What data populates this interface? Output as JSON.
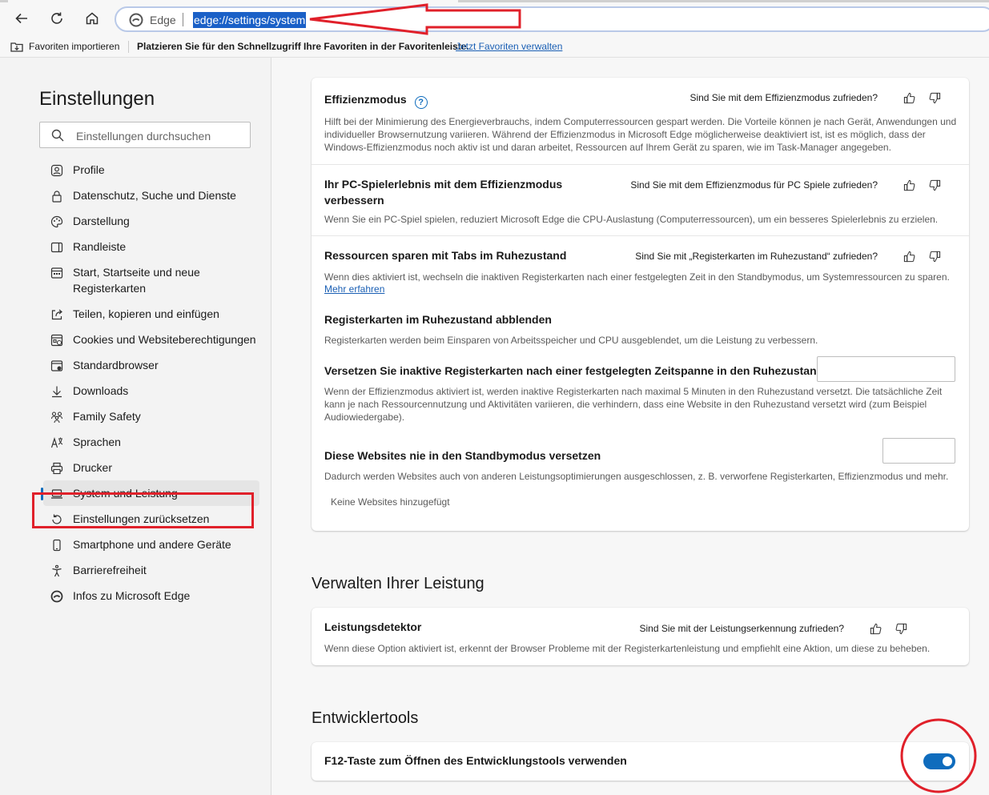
{
  "browser": {
    "address_prefix": "Edge",
    "url": "edge://settings/system"
  },
  "favorites_bar": {
    "import_label": "Favoriten importieren",
    "message": "Platzieren Sie für den Schnellzugriff Ihre Favoriten in der Favoritenleiste.",
    "manage_link": "Jetzt Favoriten verwalten"
  },
  "sidebar": {
    "title": "Einstellungen",
    "search_placeholder": "Einstellungen durchsuchen",
    "items": [
      {
        "label": "Profile",
        "icon": "profile-icon"
      },
      {
        "label": "Datenschutz, Suche und Dienste",
        "icon": "lock-icon"
      },
      {
        "label": "Darstellung",
        "icon": "palette-icon"
      },
      {
        "label": "Randleiste",
        "icon": "sidebar-panel-icon"
      },
      {
        "label": "Start, Startseite und neue Registerkarten",
        "icon": "home-grid-icon"
      },
      {
        "label": "Teilen, kopieren und einfügen",
        "icon": "share-icon"
      },
      {
        "label": "Cookies und Websiteberechtigungen",
        "icon": "cookie-permissions-icon"
      },
      {
        "label": "Standardbrowser",
        "icon": "browser-icon"
      },
      {
        "label": "Downloads",
        "icon": "download-icon"
      },
      {
        "label": "Family Safety",
        "icon": "family-icon"
      },
      {
        "label": "Sprachen",
        "icon": "language-icon"
      },
      {
        "label": "Drucker",
        "icon": "printer-icon"
      },
      {
        "label": "System und Leistung",
        "icon": "laptop-icon",
        "active": true
      },
      {
        "label": "Einstellungen zurücksetzen",
        "icon": "reset-icon"
      },
      {
        "label": "Smartphone und andere Geräte",
        "icon": "phone-icon"
      },
      {
        "label": "Barrierefreiheit",
        "icon": "accessibility-icon"
      },
      {
        "label": "Infos zu Microsoft Edge",
        "icon": "edge-logo-icon"
      }
    ]
  },
  "main": {
    "efficiency_card": {
      "efficiency_mode": {
        "title": "Effizienzmodus",
        "feedback": "Sind Sie mit dem Effizienzmodus zufrieden?",
        "desc": "Hilft bei der Minimierung des Energieverbrauchs, indem Computerressourcen gespart werden. Die Vorteile können je nach Gerät, Anwendungen und individueller Browsernutzung variieren. Während der Effizienzmodus in Microsoft Edge möglicherweise deaktiviert ist, ist es möglich, dass der Windows-Effizienzmodus noch aktiv ist und daran arbeitet, Ressourcen auf Ihrem Gerät zu sparen, wie im Task-Manager angegeben."
      },
      "gaming": {
        "title": "Ihr PC-Spielerlebnis mit dem Effizienzmodus verbessern",
        "feedback": "Sind Sie mit dem Effizienzmodus für PC Spiele zufrieden?",
        "desc": "Wenn Sie ein PC-Spiel spielen, reduziert Microsoft Edge die CPU-Auslastung (Computerressourcen), um ein besseres Spielerlebnis zu erzielen."
      },
      "sleeping_tabs": {
        "title": "Ressourcen sparen mit Tabs im Ruhezustand",
        "feedback": "Sind Sie mit „Registerkarten im Ruhezustand“ zufrieden?",
        "desc": "Wenn dies aktiviert ist, wechseln die inaktiven Registerkarten nach einer festgelegten Zeit in den Standbymodus, um Systemressourcen zu sparen.",
        "learn_more": "Mehr erfahren",
        "fade_title": "Registerkarten im Ruhezustand abblenden",
        "fade_desc": "Registerkarten werden beim Einsparen von Arbeitsspeicher und CPU ausgeblendet, um die Leistung zu verbessern.",
        "timeout_title": "Versetzen Sie inaktive Registerkarten nach einer festgelegten Zeitspanne in den Ruhezustand:",
        "timeout_desc": "Wenn der Effizienzmodus aktiviert ist, werden inaktive Registerkarten nach maximal 5 Minuten in den Ruhezustand versetzt. Die tatsächliche Zeit kann je nach Ressourcennutzung und Aktivitäten variieren, die verhindern, dass eine Website in den Ruhezustand versetzt wird (zum Beispiel Audiowiedergabe).",
        "never_title": "Diese Websites nie in den Standbymodus versetzen",
        "never_desc": "Dadurch werden Websites auch von anderen Leistungsoptimierungen ausgeschlossen, z. B. verworfene Registerkarten, Effizienzmodus und mehr.",
        "empty_text": "Keine Websites hinzugefügt"
      }
    },
    "performance_section": {
      "heading": "Verwalten Ihrer Leistung",
      "detector_title": "Leistungsdetektor",
      "detector_feedback": "Sind Sie mit der Leistungserkennung zufrieden?",
      "detector_desc": "Wenn diese Option aktiviert ist, erkennt der Browser Probleme mit der Registerkartenleistung und empfiehlt eine Aktion, um diese zu beheben."
    },
    "devtools_section": {
      "heading": "Entwicklertools",
      "f12_title": "F12-Taste zum Öffnen des Entwicklungstools verwenden",
      "f12_enabled": true
    }
  },
  "colors": {
    "accent": "#0f6cbd",
    "annotation_red": "#e0202a"
  }
}
